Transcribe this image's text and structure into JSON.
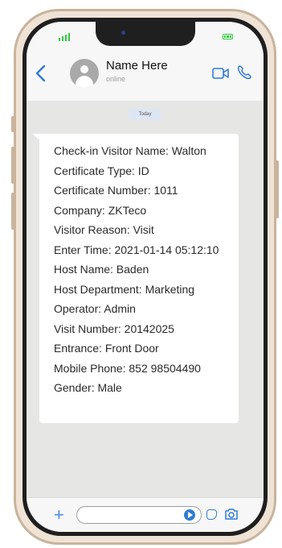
{
  "header": {
    "contact_name": "Name Here",
    "contact_status": "online"
  },
  "chat": {
    "date_label": "Today",
    "message_lines": [
      "Check-in Visitor Name: Walton",
      "Certificate Type: ID",
      "Certificate Number: 1011",
      "Company: ZKTeco",
      "Visitor Reason: Visit",
      "Enter Time: 2021-01-14 05:12:10",
      "Host Name: Baden",
      "Host Department: Marketing",
      "Operator: Admin",
      "Visit Number: 20142025",
      "Entrance: Front Door",
      "Mobile Phone: 852 98504490",
      "Gender: Male"
    ]
  },
  "icons": {
    "status_bar": [
      "signal-icon",
      "battery-icon"
    ],
    "header": [
      "back-icon",
      "avatar",
      "video-call-icon",
      "phone-call-icon"
    ],
    "input_bar": [
      "plus-icon",
      "send-icon",
      "sticker-icon",
      "camera-icon"
    ]
  },
  "colors": {
    "accent": "#2f7bd6",
    "status_green": "#2ecc40",
    "frame": "#c9b39c",
    "chat_background": "#e6e6e4",
    "bubble": "#ffffff"
  }
}
